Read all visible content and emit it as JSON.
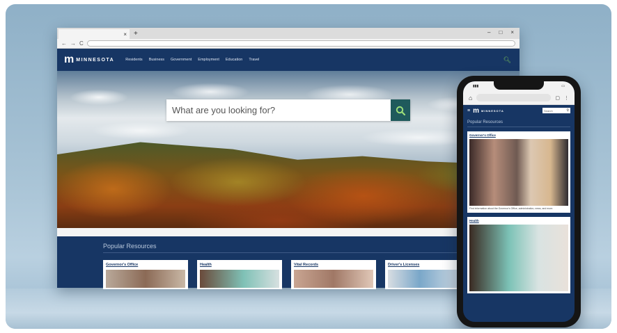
{
  "browser": {
    "tab_close": "×",
    "new_tab": "+",
    "win_controls": [
      "–",
      "□",
      "×"
    ],
    "nav_glyphs": [
      "←",
      "→",
      "C"
    ]
  },
  "site": {
    "logo_mark": "m",
    "logo_text": "MINNESOTA",
    "menu": [
      "Residents",
      "Business",
      "Government",
      "Employment",
      "Education",
      "Travel"
    ],
    "search_placeholder": "What are you looking for?",
    "popular_title": "Popular Resources",
    "cards": [
      {
        "title": "Governor's Office"
      },
      {
        "title": "Health"
      },
      {
        "title": "Vital Records"
      },
      {
        "title": "Driver's Licenses"
      }
    ]
  },
  "phone": {
    "search_placeholder": "Search",
    "popular_title": "Popular Resources",
    "cards": [
      {
        "title": "Governor's Office",
        "desc": "Find information about the Governor's Office, administration, news, and more."
      },
      {
        "title": "Health"
      }
    ]
  },
  "icons": {
    "search": "search-icon",
    "home": "home-icon",
    "menu": "menu-icon"
  },
  "colors": {
    "brand_navy": "#173664",
    "search_button": "#1f5a5c",
    "accent_green": "#78c257"
  }
}
